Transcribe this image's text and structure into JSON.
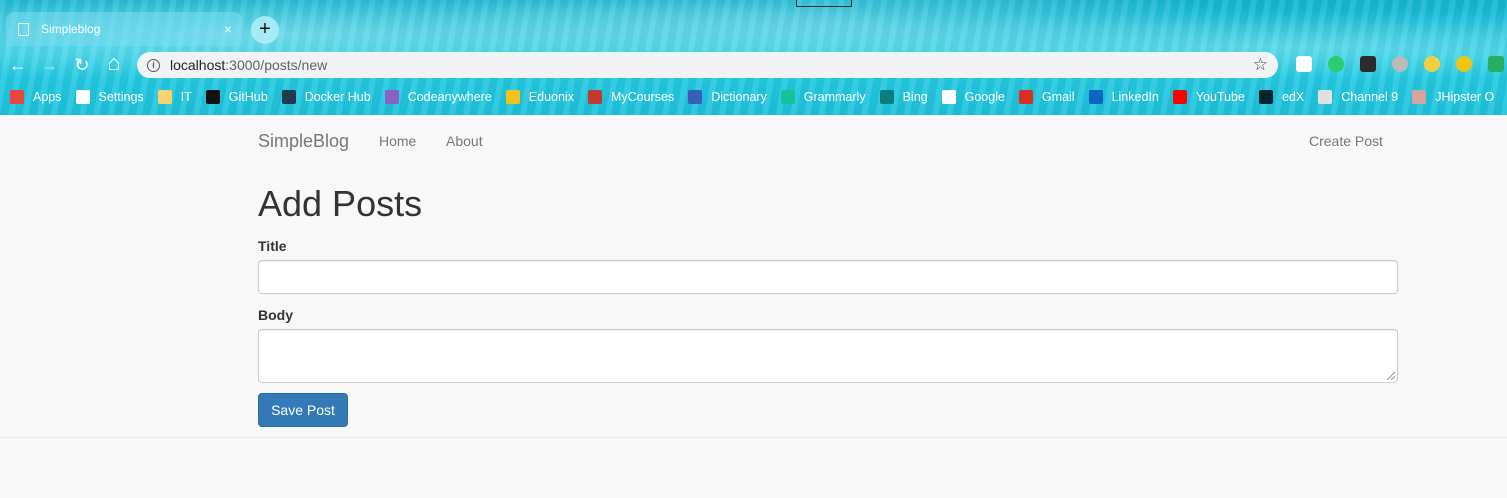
{
  "browser": {
    "tab_title": "Simpleblog",
    "tab_close": "×",
    "new_tab": "+",
    "url_host": "localhost",
    "url_path": ":3000/posts/new",
    "nav_icons": {
      "back": "←",
      "forward": "→",
      "reload": "↻",
      "home": "⌂",
      "star": "☆"
    },
    "bookmarks": [
      {
        "label": "Apps",
        "icon": "apps-grid-icon",
        "color": "#e8453c"
      },
      {
        "label": "Settings",
        "icon": "gear-icon",
        "color": "#ffffff"
      },
      {
        "label": "IT",
        "icon": "folder-icon",
        "color": "#f6d36b"
      },
      {
        "label": "GitHub",
        "icon": "github-icon",
        "color": "#111111"
      },
      {
        "label": "Docker Hub",
        "icon": "docker-icon",
        "color": "#1d3a4e"
      },
      {
        "label": "Codeanywhere",
        "icon": "codeanywhere-icon",
        "color": "#8b5fc7"
      },
      {
        "label": "Eduonix",
        "icon": "eduonix-icon",
        "color": "#f3c21a"
      },
      {
        "label": "MyCourses",
        "icon": "mycourses-icon",
        "color": "#c0392b"
      },
      {
        "label": "Dictionary",
        "icon": "dictionary-icon",
        "color": "#3a5fb8"
      },
      {
        "label": "Grammarly",
        "icon": "grammarly-icon",
        "color": "#15c39a"
      },
      {
        "label": "Bing",
        "icon": "bing-icon",
        "color": "#0a7d7d"
      },
      {
        "label": "Google",
        "icon": "google-icon",
        "color": "#ffffff"
      },
      {
        "label": "Gmail",
        "icon": "gmail-icon",
        "color": "#d93025"
      },
      {
        "label": "LinkedIn",
        "icon": "linkedin-icon",
        "color": "#0a66c2"
      },
      {
        "label": "YouTube",
        "icon": "youtube-icon",
        "color": "#ff0000"
      },
      {
        "label": "edX",
        "icon": "edx-icon",
        "color": "#02262b"
      },
      {
        "label": "Channel 9",
        "icon": "channel9-icon",
        "color": "#e0e0e0"
      },
      {
        "label": "JHipster O",
        "icon": "jhipster-icon",
        "color": "#d6a3a3"
      }
    ]
  },
  "site": {
    "brand": "SimpleBlog",
    "nav": {
      "home": "Home",
      "about": "About",
      "create_post": "Create Post"
    }
  },
  "form": {
    "heading": "Add Posts",
    "title_label": "Title",
    "title_value": "",
    "body_label": "Body",
    "body_value": "",
    "submit_label": "Save Post"
  },
  "colors": {
    "primary_button": "#337ab7",
    "page_background": "#f8f8f8"
  }
}
